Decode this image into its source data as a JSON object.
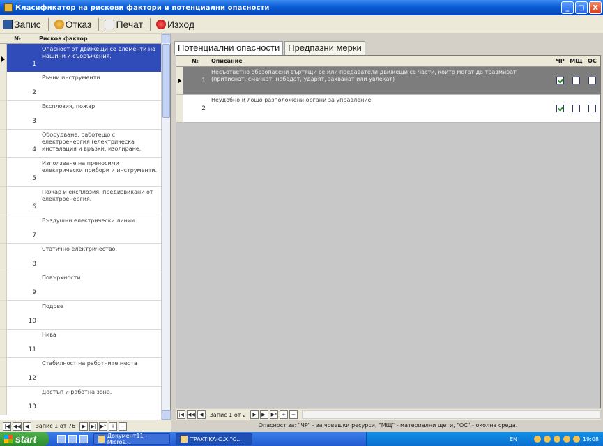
{
  "window": {
    "title": "Класификатор на рискови фактори и потенциални опасности",
    "controls": [
      "_",
      "□",
      "X"
    ]
  },
  "toolbar": {
    "save": "Запис",
    "cancel": "Отказ",
    "print": "Печат",
    "exit": "Изход"
  },
  "left_panel": {
    "col_num": "№",
    "col_factor": "Рисков фактор",
    "rows": [
      {
        "num": "1",
        "text": "Опасност от движещи се елементи на машини и съоръжения."
      },
      {
        "num": "2",
        "text": "Ръчни инструменти"
      },
      {
        "num": "3",
        "text": "Експлозия, пожар"
      },
      {
        "num": "4",
        "text": "Оборудване, работещо с електроенергия (електрическа инсталация и връзки, изолиране,"
      },
      {
        "num": "5",
        "text": "Използване на преносими електрически прибори и инструменти."
      },
      {
        "num": "6",
        "text": "Пожар и експлозия, предизвикани от електроенергия."
      },
      {
        "num": "7",
        "text": "Въздушни електрически линии"
      },
      {
        "num": "8",
        "text": "Статично електричество."
      },
      {
        "num": "9",
        "text": "Повърхности"
      },
      {
        "num": "10",
        "text": "Подове"
      },
      {
        "num": "11",
        "text": "Нива"
      },
      {
        "num": "12",
        "text": "Стабилност на работните места"
      },
      {
        "num": "13",
        "text": "Достъп и работна зона."
      }
    ],
    "nav": {
      "first": "|◀",
      "prev2": "◀◀",
      "prev": "◀",
      "label": "Запис 1 от 76",
      "next": "▶",
      "next2": "▶|",
      "last": "▶*",
      "add": "+",
      "remove": "−"
    }
  },
  "right_panel": {
    "tabs": [
      "Потенциални опасности",
      "Предпазни мерки"
    ],
    "headers": {
      "num": "№",
      "desc": "Описание",
      "chr": "ЧР",
      "msh": "МЩ",
      "os": "ОС"
    },
    "rows": [
      {
        "num": "1",
        "desc": "Несъответно обезопасени въртящи се или предаватели движещи се части, които могат да травмират (притиснат, смачкат, нободат, ударят, захванат или увлекат)",
        "chr": true,
        "msh": false,
        "os": false
      },
      {
        "num": "2",
        "desc": "Неудобно и лошо разположени органи за управление",
        "chr": true,
        "msh": false,
        "os": false
      }
    ],
    "nav": {
      "first": "|◀",
      "prev2": "◀◀",
      "prev": "◀",
      "label": "Запис 1 от 2",
      "next": "▶",
      "next2": "▶|",
      "last": "▶*",
      "add": "+",
      "remove": "−"
    },
    "note": "Опасност за: \"ЧР\" - за човешки ресурси, \"МЩ\" - материални щети, \"ОС\" - околна среда."
  },
  "taskbar": {
    "start": "start",
    "tasks": [
      "Документ11 - Micros...",
      "TPAKTIKA-O.X.\"O..."
    ],
    "lang": "EN",
    "clock": "19:08"
  }
}
